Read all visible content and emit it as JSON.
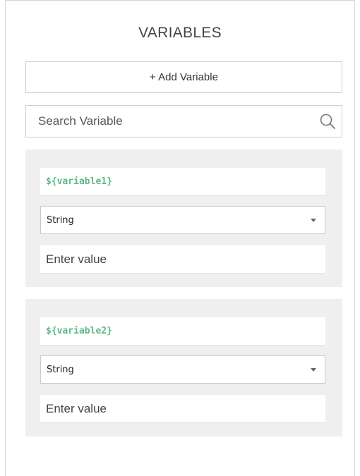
{
  "panel": {
    "title": "VARIABLES",
    "add_button_label": "+ Add Variable",
    "search": {
      "placeholder": "Search Variable",
      "value": ""
    },
    "variables": [
      {
        "name": "${variable1}",
        "type": "String",
        "value_placeholder": "Enter value"
      },
      {
        "name": "${variable2}",
        "type": "String",
        "value_placeholder": "Enter value"
      }
    ]
  },
  "colors": {
    "variable_name": "#5cb88a",
    "card_background": "#efefef",
    "border": "#cfcfcf"
  },
  "icons": {
    "search": "search-icon",
    "dropdown": "chevron-down-icon"
  }
}
